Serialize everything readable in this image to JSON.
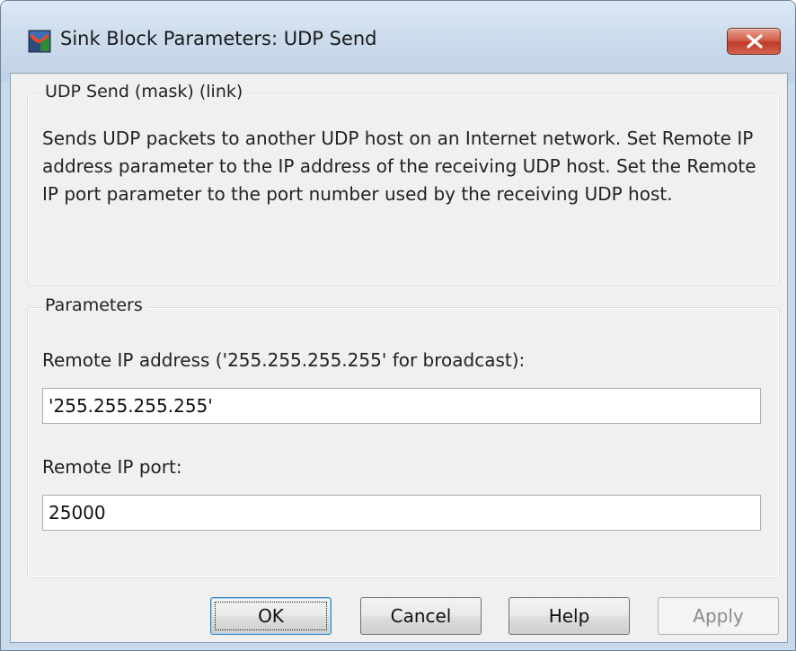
{
  "window": {
    "title": "Sink Block Parameters: UDP Send",
    "icon": "simulink-block-icon",
    "close_icon": "close-icon"
  },
  "description_group": {
    "title": "UDP Send (mask) (link)",
    "text": "Sends UDP packets to another UDP host on an Internet network. Set Remote IP address parameter to the IP address of the receiving UDP host. Set the Remote IP port parameter to the port number used by the receiving UDP host."
  },
  "parameters_group": {
    "title": "Parameters",
    "fields": [
      {
        "label": "Remote IP address ('255.255.255.255' for broadcast):",
        "value": "'255.255.255.255'"
      },
      {
        "label": "Remote IP port:",
        "value": "25000"
      }
    ]
  },
  "buttons": {
    "ok": "OK",
    "cancel": "Cancel",
    "help": "Help",
    "apply": "Apply"
  },
  "colors": {
    "titlebar": "#cddcec",
    "close_button": "#c0392b",
    "dialog_background": "#f0f0f0",
    "default_button_border": "#3c7fb1"
  }
}
